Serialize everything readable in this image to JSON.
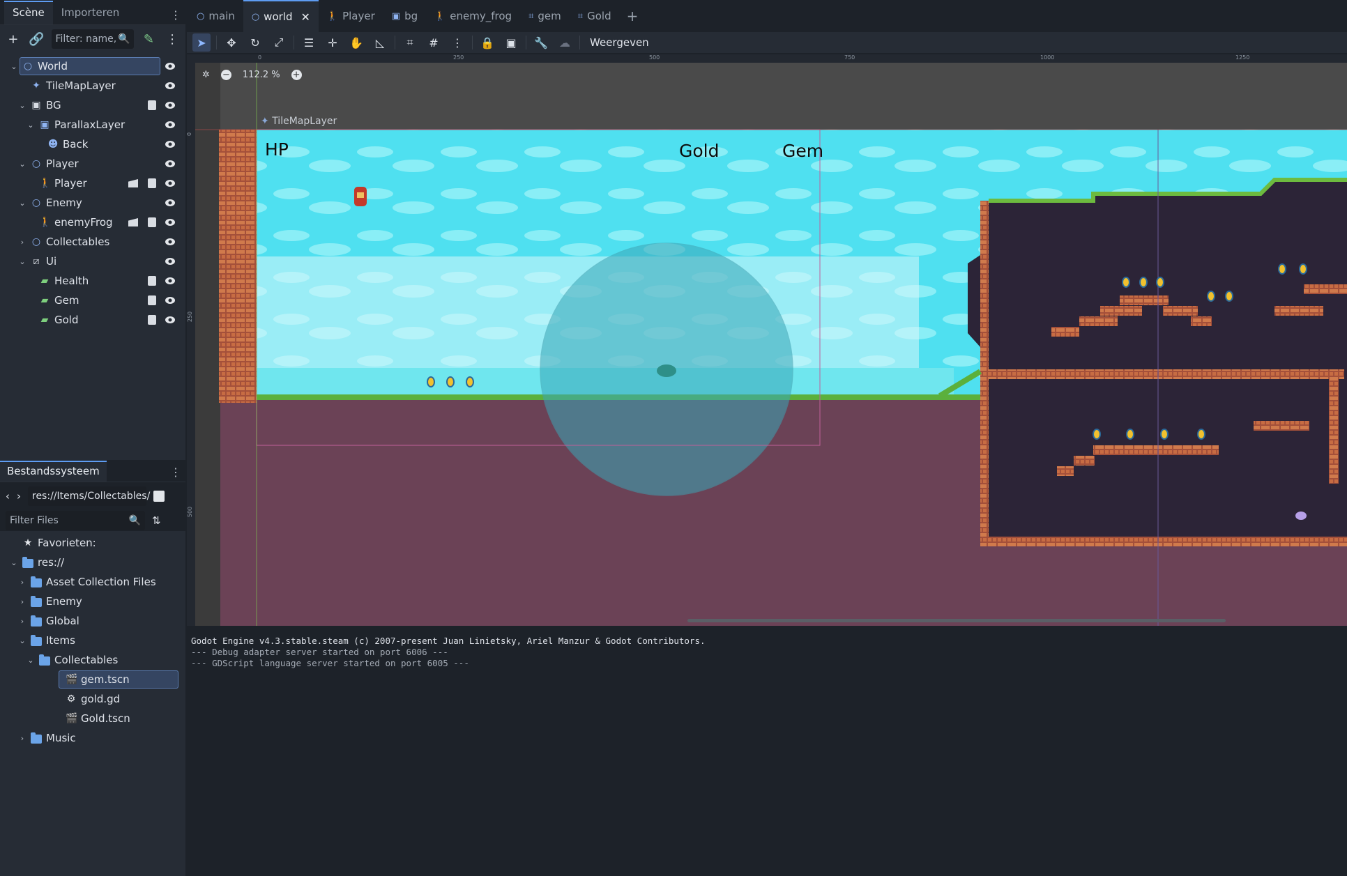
{
  "left_dock": {
    "tabs": [
      "Scène",
      "Importeren"
    ],
    "filter_placeholder": "Filter: name,",
    "scene_tree": [
      {
        "label": "World",
        "icon": "node2d-icon",
        "selected": true
      },
      {
        "label": "TileMapLayer",
        "icon": "tilemap-icon"
      },
      {
        "label": "BG",
        "icon": "canvas-icon"
      },
      {
        "label": "ParallaxLayer",
        "icon": "parallax-icon"
      },
      {
        "label": "Back",
        "icon": "sprite-icon"
      },
      {
        "label": "Player",
        "icon": "node2d-icon"
      },
      {
        "label": "Player",
        "icon": "character-icon"
      },
      {
        "label": "Enemy",
        "icon": "node2d-icon"
      },
      {
        "label": "enemyFrog",
        "icon": "character-icon"
      },
      {
        "label": "Collectables",
        "icon": "node2d-icon"
      },
      {
        "label": "Ui",
        "icon": "canvaslayer-icon"
      },
      {
        "label": "Health",
        "icon": "label-icon"
      },
      {
        "label": "Gem",
        "icon": "label-icon"
      },
      {
        "label": "Gold",
        "icon": "label-icon"
      }
    ]
  },
  "filesystem": {
    "tab": "Bestandssysteem",
    "path": "res://Items/Collectables/",
    "filter_placeholder": "Filter Files",
    "items": [
      {
        "label": "Favorieten:",
        "icon": "star-icon"
      },
      {
        "label": "res://",
        "icon": "folder-icon"
      },
      {
        "label": "Asset Collection Files",
        "icon": "folder-icon"
      },
      {
        "label": "Enemy",
        "icon": "folder-icon"
      },
      {
        "label": "Global",
        "icon": "folder-icon"
      },
      {
        "label": "Items",
        "icon": "folder-icon"
      },
      {
        "label": "Collectables",
        "icon": "folder-icon"
      },
      {
        "label": "gem.tscn",
        "icon": "scene-file-icon",
        "selected": true
      },
      {
        "label": "gold.gd",
        "icon": "gear-icon"
      },
      {
        "label": "Gold.tscn",
        "icon": "scene-file-icon"
      },
      {
        "label": "Music",
        "icon": "folder-icon"
      }
    ]
  },
  "scene_tabs": [
    {
      "label": "main",
      "icon": "node2d-icon"
    },
    {
      "label": "world",
      "icon": "node2d-icon",
      "active": true
    },
    {
      "label": "Player",
      "icon": "character-icon"
    },
    {
      "label": "bg",
      "icon": "canvas-icon"
    },
    {
      "label": "enemy_frog",
      "icon": "character-icon"
    },
    {
      "label": "gem",
      "icon": "area-icon"
    },
    {
      "label": "Gold",
      "icon": "area-icon"
    }
  ],
  "editor_toolbar": {
    "view_menu": "Weergeven"
  },
  "viewport": {
    "zoom": "112.2 %",
    "node_label": "TileMapLayer",
    "ui_labels": [
      "HP",
      "Gold",
      "Gem"
    ],
    "ruler_top": [
      "0",
      "250",
      "500",
      "750",
      "1000",
      "1250"
    ],
    "ruler_left": [
      "0",
      "250",
      "500"
    ]
  },
  "output": [
    "Godot Engine v4.3.stable.steam (c) 2007-present Juan Linietsky, Ariel Manzur & Godot Contributors.",
    "--- Debug adapter server started on port 6006 ---",
    "--- GDScript language server started on port 6005 ---"
  ],
  "colors": {
    "accent": "#5e9cf2",
    "sky": "#4fe0f0",
    "cave": "#2c2437",
    "ground_fill": "#6b4256",
    "brick": "#c0663e"
  }
}
